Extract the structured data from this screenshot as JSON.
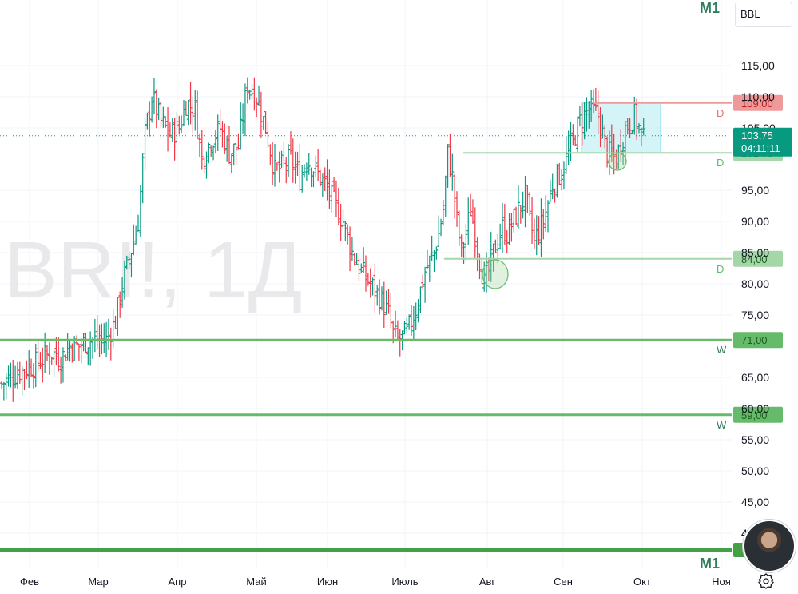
{
  "symbol": "BBL",
  "watermark": "BRI!, 1Д",
  "timeframe_top": "M1",
  "timeframe_bottom": "M1",
  "current_price": {
    "value": "103,75",
    "countdown": "04:11:11",
    "price": 103.75,
    "color": "#089981"
  },
  "colors": {
    "up": "#089981",
    "down": "#f23645",
    "level": "#4caf50",
    "level_light": "#a5d6a7",
    "resistance": "#ef9a9a",
    "zone": "#b2ebf2"
  },
  "levels": [
    {
      "price": 109,
      "label": "109,00",
      "tag": "D",
      "style": "red"
    },
    {
      "price": 101,
      "label": "101,00",
      "tag": "D",
      "style": "light"
    },
    {
      "price": 84,
      "label": "84,00",
      "tag": "D",
      "style": "light"
    },
    {
      "price": 71,
      "label": "71,00",
      "tag": "W",
      "style": "thick"
    },
    {
      "price": 59,
      "label": "59,00",
      "tag": "W",
      "style": "thick"
    },
    {
      "price": 37,
      "label": "",
      "tag": "",
      "style": "thickest"
    }
  ],
  "chart_data": {
    "type": "ohlc",
    "y_ticks": [
      "115,00",
      "110,00",
      "105,00",
      "95,00",
      "90,00",
      "85,00",
      "80,00",
      "75,00",
      "65,00",
      "60,00",
      "55,00",
      "50,00",
      "45,00",
      "40,00"
    ],
    "y_tick_values": [
      115,
      110,
      105,
      95,
      90,
      85,
      80,
      75,
      65,
      60,
      55,
      50,
      45,
      40
    ],
    "ylim": [
      37,
      124
    ],
    "months": [
      "Фев",
      "Мар",
      "Апр",
      "Май",
      "Июн",
      "Июль",
      "Авг",
      "Сен",
      "Окт",
      "Ноя"
    ],
    "waypoints": [
      [
        0,
        64
      ],
      [
        8,
        66
      ],
      [
        14,
        67
      ],
      [
        22,
        69
      ],
      [
        26,
        68
      ],
      [
        30,
        70
      ],
      [
        34,
        70
      ],
      [
        38,
        71
      ],
      [
        42,
        71
      ],
      [
        46,
        71
      ],
      [
        50,
        74
      ],
      [
        53,
        80
      ],
      [
        56,
        84
      ],
      [
        60,
        90
      ],
      [
        63,
        104
      ],
      [
        66,
        110
      ],
      [
        70,
        106
      ],
      [
        74,
        104
      ],
      [
        78,
        105
      ],
      [
        81,
        109
      ],
      [
        85,
        108
      ],
      [
        88,
        100
      ],
      [
        92,
        103
      ],
      [
        96,
        105
      ],
      [
        100,
        101
      ],
      [
        104,
        102
      ],
      [
        108,
        112
      ],
      [
        112,
        110
      ],
      [
        116,
        105
      ],
      [
        120,
        98
      ],
      [
        124,
        99
      ],
      [
        127,
        100
      ],
      [
        131,
        97
      ],
      [
        134,
        100
      ],
      [
        138,
        98
      ],
      [
        142,
        96
      ],
      [
        146,
        93
      ],
      [
        150,
        90
      ],
      [
        154,
        85
      ],
      [
        158,
        82
      ],
      [
        162,
        80
      ],
      [
        166,
        78
      ],
      [
        170,
        75
      ],
      [
        172,
        72
      ],
      [
        174,
        71
      ],
      [
        178,
        72
      ],
      [
        182,
        76
      ],
      [
        186,
        82
      ],
      [
        190,
        85
      ],
      [
        192,
        88
      ],
      [
        194,
        92
      ],
      [
        196,
        101
      ],
      [
        198,
        97
      ],
      [
        200,
        90
      ],
      [
        202,
        85
      ],
      [
        204,
        88
      ],
      [
        206,
        92
      ],
      [
        208,
        88
      ],
      [
        210,
        84
      ],
      [
        212,
        80
      ],
      [
        214,
        82
      ],
      [
        216,
        85
      ],
      [
        218,
        87
      ],
      [
        220,
        89
      ],
      [
        222,
        88
      ],
      [
        226,
        91
      ],
      [
        230,
        94
      ],
      [
        232,
        90
      ],
      [
        234,
        87
      ],
      [
        238,
        90
      ],
      [
        242,
        96
      ],
      [
        246,
        98
      ],
      [
        250,
        102
      ],
      [
        254,
        106
      ],
      [
        258,
        108
      ],
      [
        262,
        107
      ],
      [
        266,
        101
      ],
      [
        270,
        100
      ],
      [
        274,
        105
      ],
      [
        278,
        107
      ],
      [
        282,
        103
      ]
    ],
    "channel_zone": {
      "start_day": 250,
      "end_day": 282,
      "top": 109,
      "bottom": 101
    }
  }
}
